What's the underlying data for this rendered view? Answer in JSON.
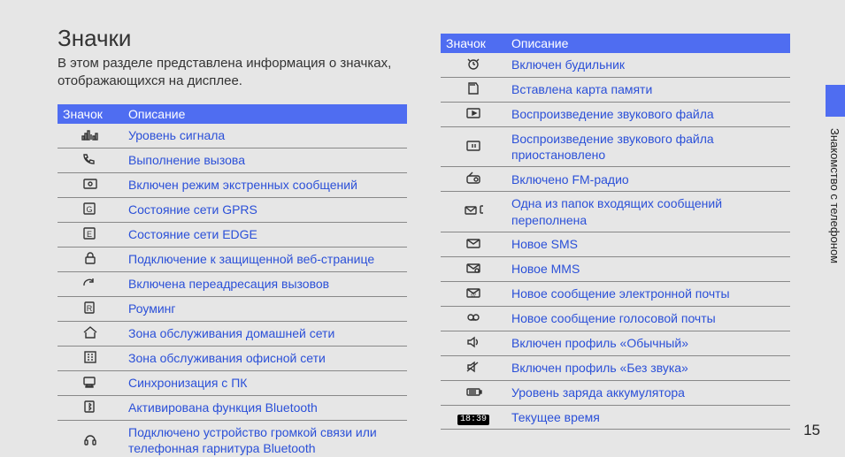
{
  "title": "Значки",
  "intro": "В этом разделе представлена информация о значках, отображающихся на дисплее.",
  "side_label": "Знакомство с телефоном",
  "page_number": "15",
  "headers": {
    "icon": "Значок",
    "desc": "Описание"
  },
  "time_chip": "18:39",
  "left_rows": [
    {
      "icon": "signal",
      "desc": "Уровень сигнала"
    },
    {
      "icon": "call",
      "desc": "Выполнение вызова"
    },
    {
      "icon": "sos",
      "desc": "Включен режим экстренных сообщений"
    },
    {
      "icon": "gprs",
      "desc": "Состояние сети GPRS"
    },
    {
      "icon": "edge",
      "desc": "Состояние сети EDGE"
    },
    {
      "icon": "lock",
      "desc": "Подключение к защищенной веб-странице"
    },
    {
      "icon": "fwd",
      "desc": "Включена переадресация вызовов"
    },
    {
      "icon": "roam",
      "desc": "Роуминг"
    },
    {
      "icon": "home",
      "desc": "Зона обслуживания домашней сети"
    },
    {
      "icon": "office",
      "desc": "Зона обслуживания офисной сети"
    },
    {
      "icon": "sync",
      "desc": "Синхронизация с ПК"
    },
    {
      "icon": "bt",
      "desc": "Активирована функция Bluetooth"
    },
    {
      "icon": "bthead",
      "desc": "Подключено устройство громкой связи или телефонная гарнитура Bluetooth"
    }
  ],
  "right_rows": [
    {
      "icon": "alarm",
      "desc": "Включен будильник"
    },
    {
      "icon": "sdcard",
      "desc": "Вставлена карта памяти"
    },
    {
      "icon": "play",
      "desc": "Воспроизведение звукового файла"
    },
    {
      "icon": "pause",
      "desc": "Воспроизведение звукового файла приостановлено"
    },
    {
      "icon": "fm",
      "desc": "Включено FM-радио"
    },
    {
      "icon": "inbox",
      "desc": "Одна из папок входящих сообщений переполнена"
    },
    {
      "icon": "sms",
      "desc": "Новое SMS"
    },
    {
      "icon": "mms",
      "desc": "Новое MMS"
    },
    {
      "icon": "email",
      "desc": "Новое сообщение электронной почты"
    },
    {
      "icon": "vmail",
      "desc": "Новое сообщение голосовой почты"
    },
    {
      "icon": "sound",
      "desc": "Включен профиль «Обычный»"
    },
    {
      "icon": "mute",
      "desc": "Включен профиль «Без звука»"
    },
    {
      "icon": "battery",
      "desc": "Уровень заряда аккумулятора"
    },
    {
      "icon": "time",
      "desc": "Текущее время"
    }
  ]
}
